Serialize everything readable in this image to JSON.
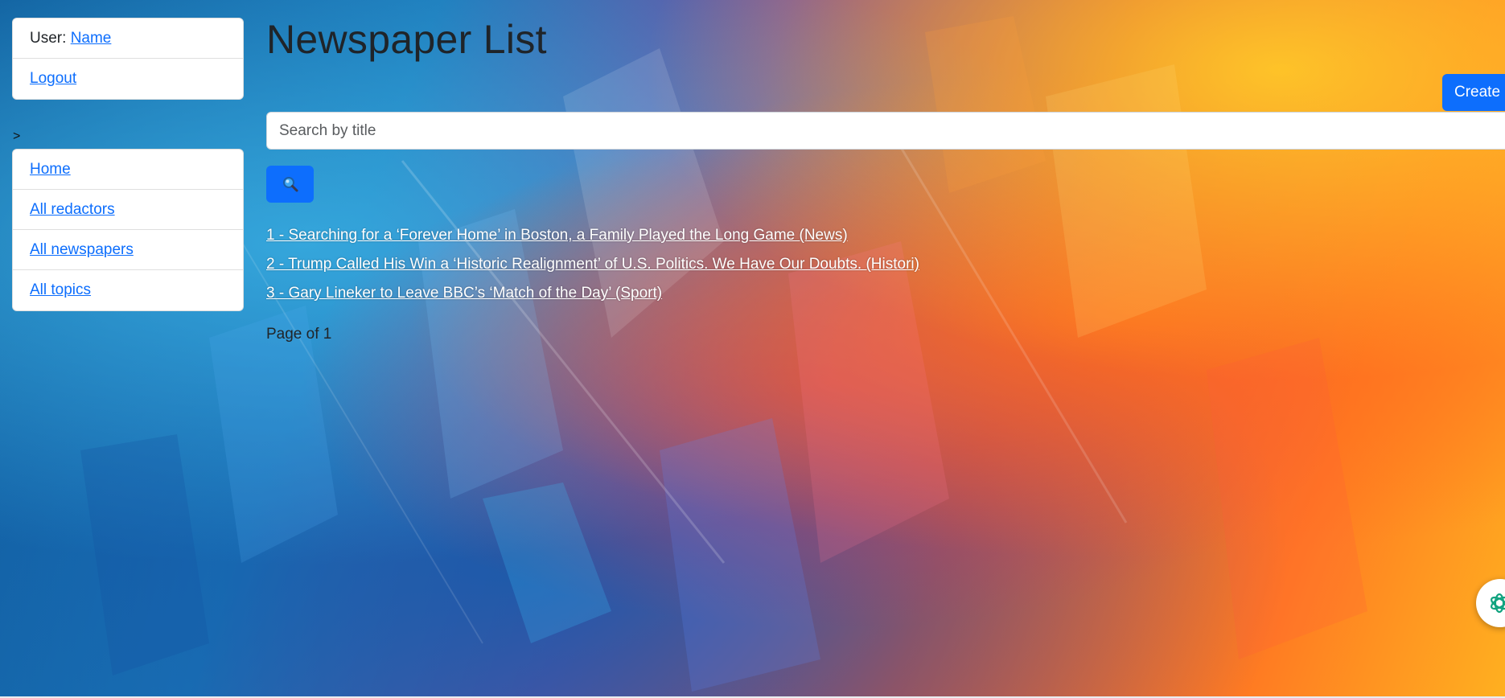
{
  "sidebar": {
    "user_label": "User:",
    "user_name": "Name",
    "logout": "Logout",
    "arrow": ">",
    "nav": [
      {
        "label": "Home"
      },
      {
        "label": "All redactors"
      },
      {
        "label": "All newspapers"
      },
      {
        "label": "All topics"
      }
    ]
  },
  "main": {
    "title": "Newspaper List",
    "create_button": "Create",
    "search": {
      "placeholder": "Search by title",
      "value": ""
    },
    "search_icon": "magnifier-icon",
    "newspapers": [
      {
        "text": "1 - Searching for a ‘Forever Home’ in Boston, a Family Played the Long Game (News)"
      },
      {
        "text": "2 - Trump Called His Win a ‘Historic Realignment’ of U.S. Politics. We Have Our Doubts. (Histori)"
      },
      {
        "text": "3 - Gary Lineker to Leave BBC’s ‘Match of the Day’ (Sport)"
      }
    ],
    "pagination": "Page of 1"
  },
  "chat_widget_icon": "chatgpt-icon",
  "colors": {
    "primary": "#0d6efd",
    "link": "#0d6efd",
    "text": "#212529"
  }
}
